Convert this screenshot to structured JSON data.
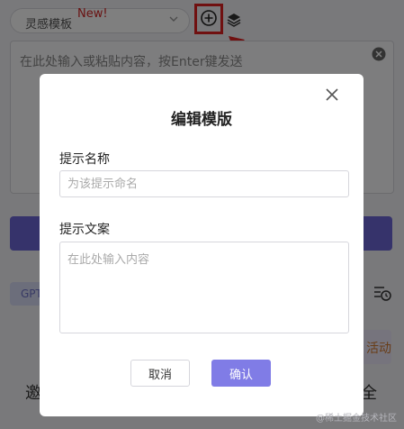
{
  "toolbar": {
    "template_select_value": "灵感模板",
    "new_badge": "New!"
  },
  "prompt": {
    "placeholder": "在此处输入或粘贴内容，按Enter键发送"
  },
  "tags": {
    "model_tag": "GPT",
    "event_tag": "活动"
  },
  "bottom": {
    "left_text": "邀",
    "right_text": "全"
  },
  "watermark": "@稀土掘金技术社区",
  "modal": {
    "title": "编辑模版",
    "name_label": "提示名称",
    "name_placeholder": "为该提示命名",
    "name_value": "",
    "copy_label": "提示文案",
    "copy_placeholder": "在此处输入内容",
    "copy_value": "",
    "cancel_label": "取消",
    "confirm_label": "确认"
  },
  "colors": {
    "annotation": "#e02020",
    "accent": "#807ce6",
    "new_badge": "#d32525"
  },
  "icons": [
    "chevron-down-icon",
    "add-circle-icon",
    "layers-icon",
    "clear-icon",
    "history-icon",
    "close-icon",
    "annotation-arrow"
  ]
}
